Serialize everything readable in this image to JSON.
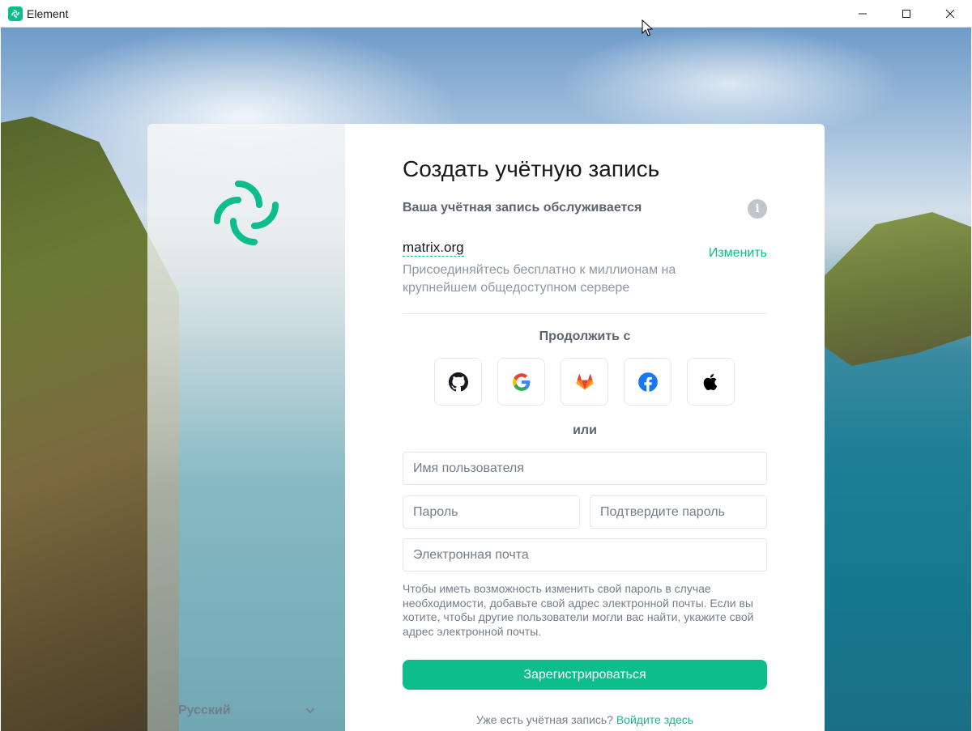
{
  "window": {
    "title": "Element",
    "controls": [
      "minimize-icon",
      "maximize-icon",
      "close-icon"
    ]
  },
  "brand": {
    "accent": "#0dbd8b",
    "logo_icon": "element-logo-icon"
  },
  "language": {
    "selected": "Русский",
    "icon": "chevron-down-icon"
  },
  "register": {
    "title": "Создать учётную запись",
    "served_label": "Ваша учётная запись обслуживается",
    "server_name": "matrix.org",
    "server_desc": "Присоединяйтесь бесплатно к миллионам на крупнейшем общедоступном сервере",
    "change_label": "Изменить",
    "continue_with": "Продолжить с",
    "sso_providers": [
      "github-icon",
      "google-icon",
      "gitlab-icon",
      "facebook-icon",
      "apple-icon"
    ],
    "or_label": "или",
    "username_placeholder": "Имя пользователя",
    "password_placeholder": "Пароль",
    "confirm_placeholder": "Подтвердите пароль",
    "email_placeholder": "Электронная почта",
    "email_hint": "Чтобы иметь возможность изменить свой пароль в случае необходимости, добавьте свой адрес электронной почты. Если вы хотите, чтобы другие пользователи могли вас найти, укажите свой адрес электронной почты.",
    "submit_label": "Зарегистрироваться",
    "have_account": "Уже есть учётная запись?",
    "login_link": "Войдите здесь"
  }
}
